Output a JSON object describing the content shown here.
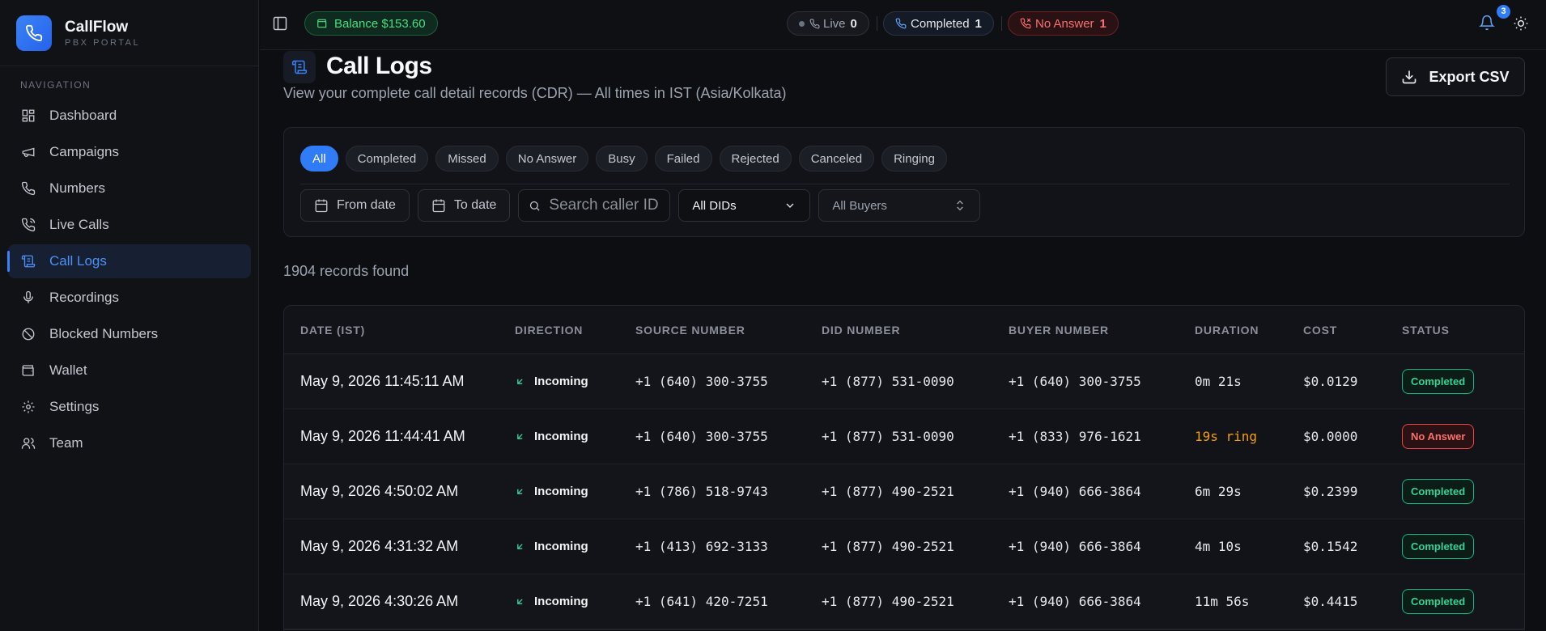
{
  "brand": {
    "name": "CallFlow",
    "subtitle": "PBX PORTAL"
  },
  "nav": {
    "title": "NAVIGATION",
    "items": [
      {
        "label": "Dashboard",
        "icon": "grid-icon"
      },
      {
        "label": "Campaigns",
        "icon": "megaphone-icon"
      },
      {
        "label": "Numbers",
        "icon": "phone-icon"
      },
      {
        "label": "Live Calls",
        "icon": "phone-call-icon"
      },
      {
        "label": "Call Logs",
        "icon": "scroll-icon",
        "active": true
      },
      {
        "label": "Recordings",
        "icon": "mic-icon"
      },
      {
        "label": "Blocked Numbers",
        "icon": "ban-icon"
      },
      {
        "label": "Wallet",
        "icon": "wallet-icon"
      },
      {
        "label": "Settings",
        "icon": "gear-icon"
      },
      {
        "label": "Team",
        "icon": "users-icon"
      }
    ]
  },
  "topbar": {
    "balance": "Balance $153.60",
    "live_label": "Live",
    "live_count": "0",
    "completed_label": "Completed",
    "completed_count": "1",
    "noanswer_label": "No Answer",
    "noanswer_count": "1",
    "notification_count": "3"
  },
  "page": {
    "title": "Call Logs",
    "subtitle": "View your complete call detail records (CDR) — All times in IST (Asia/Kolkata)",
    "export_label": "Export CSV",
    "records": "1904 records found"
  },
  "filters": {
    "chips": [
      "All",
      "Completed",
      "Missed",
      "No Answer",
      "Busy",
      "Failed",
      "Rejected",
      "Canceled",
      "Ringing"
    ],
    "from_date": "From date",
    "to_date": "To date",
    "search_placeholder": "Search caller ID...",
    "did_select": "All DIDs",
    "buyer_select": "All Buyers"
  },
  "table": {
    "headers": [
      "DATE (IST)",
      "DIRECTION",
      "SOURCE NUMBER",
      "DID NUMBER",
      "BUYER NUMBER",
      "DURATION",
      "COST",
      "STATUS"
    ],
    "rows": [
      {
        "date": "May 9, 2026 11:45:11 AM",
        "direction": "Incoming",
        "source": "+1 (640) 300-3755",
        "did": "+1 (877) 531-0090",
        "buyer": "+1 (640) 300-3755",
        "duration": "0m 21s",
        "cost": "$0.0129",
        "status": "Completed"
      },
      {
        "date": "May 9, 2026 11:44:41 AM",
        "direction": "Incoming",
        "source": "+1 (640) 300-3755",
        "did": "+1 (877) 531-0090",
        "buyer": "+1 (833) 976-1621",
        "duration": "19s ring",
        "cost": "$0.0000",
        "status": "No Answer"
      },
      {
        "date": "May 9, 2026 4:50:02 AM",
        "direction": "Incoming",
        "source": "+1 (786) 518-9743",
        "did": "+1 (877) 490-2521",
        "buyer": "+1 (940) 666-3864",
        "duration": "6m 29s",
        "cost": "$0.2399",
        "status": "Completed"
      },
      {
        "date": "May 9, 2026 4:31:32 AM",
        "direction": "Incoming",
        "source": "+1 (413) 692-3133",
        "did": "+1 (877) 490-2521",
        "buyer": "+1 (940) 666-3864",
        "duration": "4m 10s",
        "cost": "$0.1542",
        "status": "Completed"
      },
      {
        "date": "May 9, 2026 4:30:26 AM",
        "direction": "Incoming",
        "source": "+1 (641) 420-7251",
        "did": "+1 (877) 490-2521",
        "buyer": "+1 (940) 666-3864",
        "duration": "11m 56s",
        "cost": "$0.4415",
        "status": "Completed"
      }
    ]
  },
  "colors": {
    "accent": "#2f7cf6",
    "success": "#34d399",
    "danger": "#f87171",
    "warning": "#f59e0b"
  }
}
